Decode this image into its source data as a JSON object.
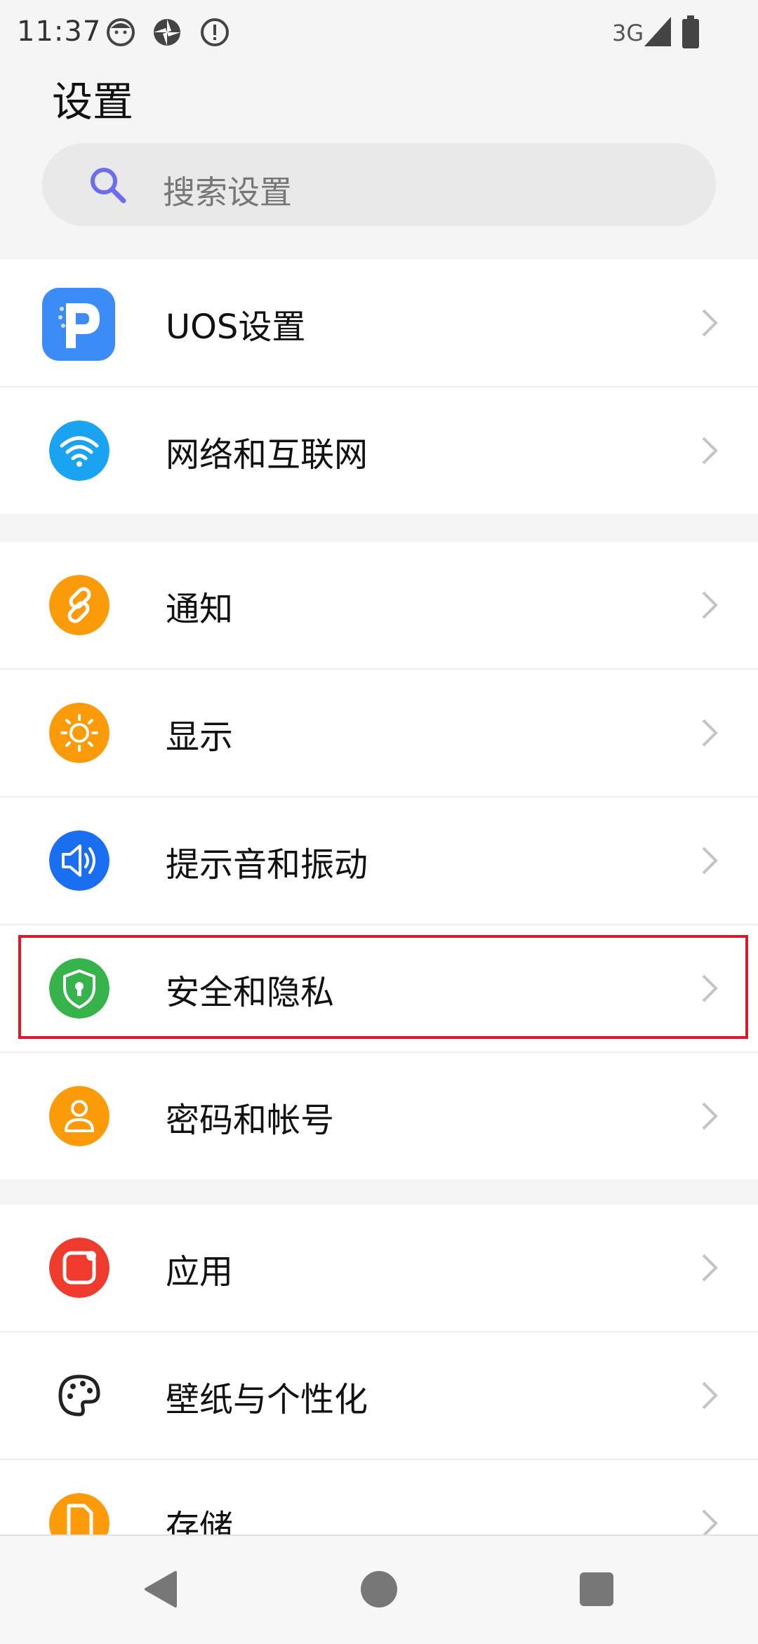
{
  "status_bar": {
    "time": "11:37",
    "network": "3G",
    "icons": [
      "face-icon",
      "aperture-icon",
      "alert-icon",
      "signal-icon",
      "battery-icon"
    ]
  },
  "page": {
    "title": "设置"
  },
  "search": {
    "placeholder": "搜索设置",
    "icon": "search-icon"
  },
  "groups": [
    {
      "items": [
        {
          "label": "UOS设置",
          "icon": "uos-logo-icon",
          "color": "#3d8bf5"
        },
        {
          "label": "网络和互联网",
          "icon": "wifi-icon",
          "color": "#1aa3f0"
        }
      ]
    },
    {
      "items": [
        {
          "label": "通知",
          "icon": "link-icon",
          "color": "#fb9b0a"
        },
        {
          "label": "显示",
          "icon": "sun-icon",
          "color": "#fb9b0a"
        },
        {
          "label": "提示音和振动",
          "icon": "speaker-icon",
          "color": "#1a6ff0"
        },
        {
          "label": "安全和隐私",
          "icon": "shield-icon",
          "color": "#36b34a"
        },
        {
          "label": "密码和帐号",
          "icon": "person-icon",
          "color": "#fb9b0a"
        }
      ]
    },
    {
      "items": [
        {
          "label": "应用",
          "icon": "app-icon",
          "color": "#ef3b2d"
        },
        {
          "label": "壁纸与个性化",
          "icon": "palette-icon",
          "color": "#ffffff"
        },
        {
          "label": "存储",
          "icon": "storage-icon",
          "color": "#fb9b0a"
        }
      ]
    }
  ],
  "highlight_color": "#d81b2c",
  "nav_bar": {
    "buttons": [
      "back-icon",
      "home-icon",
      "recents-icon"
    ]
  }
}
